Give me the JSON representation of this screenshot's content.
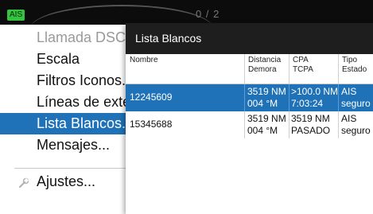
{
  "header": {
    "ais_badge": "AIS",
    "page_indicator": "0 / 2"
  },
  "menu": {
    "items": [
      {
        "label": "Llamada DSC",
        "state": "disabled"
      },
      {
        "label": "Escala",
        "state": "normal"
      },
      {
        "label": "Filtros Iconos...",
        "state": "normal"
      },
      {
        "label": "Líneas de exter",
        "state": "normal"
      },
      {
        "label": "Lista Blancos...",
        "state": "selected"
      },
      {
        "label": "Mensajes...",
        "state": "normal"
      },
      {
        "label": "Ajustes...",
        "state": "normal",
        "icon": "wrench-icon"
      }
    ]
  },
  "dialog": {
    "title": "Lista Blancos",
    "columns": [
      {
        "line1": "Nombre",
        "line2": ""
      },
      {
        "line1": "Distancia",
        "line2": "Demora"
      },
      {
        "line1": "CPA",
        "line2": "TCPA"
      },
      {
        "line1": "Tipo",
        "line2": "Estado"
      }
    ],
    "rows": [
      {
        "nombre": "12245609",
        "distancia": "3519 NM",
        "demora": "004 °M",
        "cpa": ">100.0 NM",
        "tcpa": "7:03:24",
        "tipo": "AIS",
        "estado": "seguro",
        "selected": true
      },
      {
        "nombre": "15345688",
        "distancia": "3519 NM",
        "demora": "004 °M",
        "cpa": "3519 NM",
        "tcpa": "PASADO",
        "tipo": "AIS",
        "estado": "seguro",
        "selected": false
      }
    ]
  },
  "colors": {
    "accent": "#1f72b7",
    "ais_badge": "#35c43f",
    "title_bar": "#1e1e1e"
  }
}
